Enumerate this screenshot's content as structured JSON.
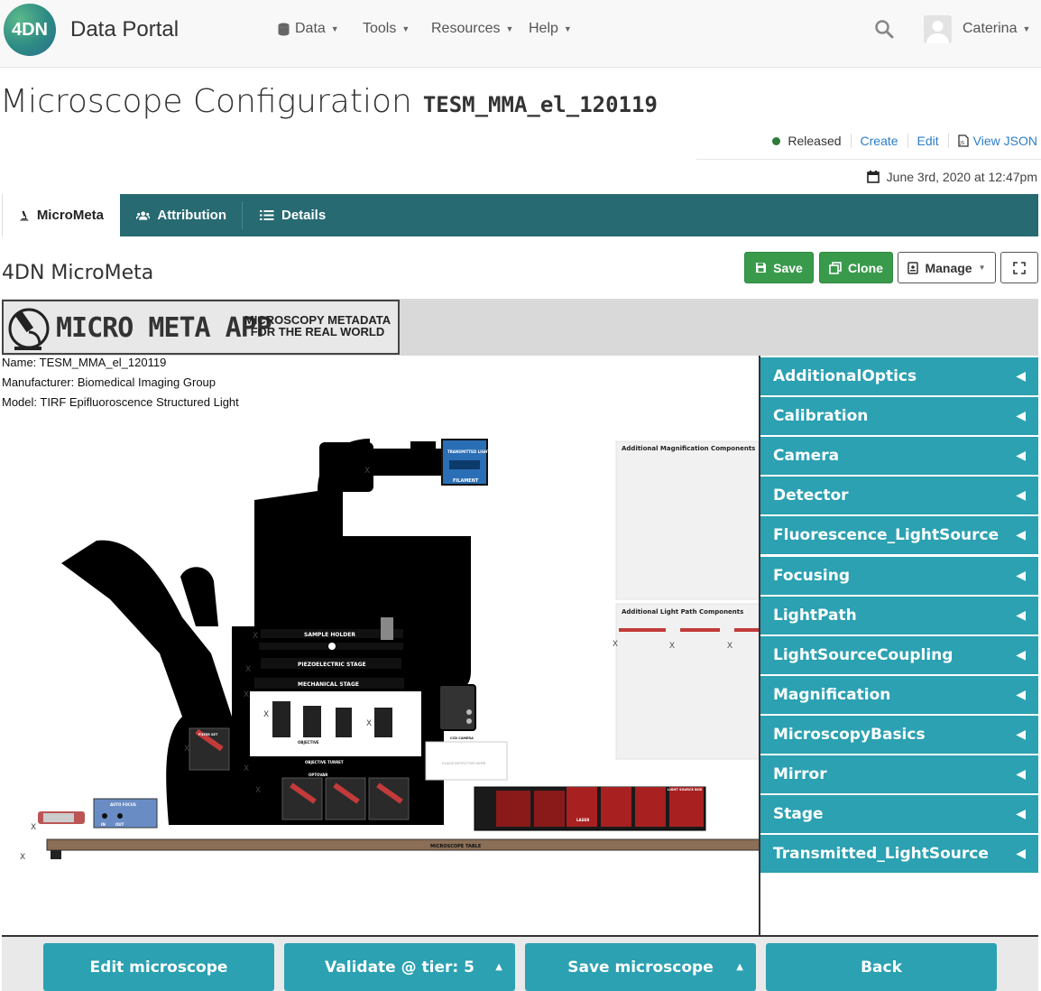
{
  "nav": {
    "logo": "4DN",
    "brand": "Data Portal",
    "menu": [
      {
        "label": "Data"
      },
      {
        "label": "Tools"
      },
      {
        "label": "Resources"
      },
      {
        "label": "Help"
      }
    ],
    "user": "Caterina"
  },
  "page": {
    "title": "Microscope Configuration",
    "accession": "TESM_MMA_el_120119",
    "status": "Released",
    "actions": [
      "Create",
      "Edit",
      "View JSON"
    ],
    "date": "June 3rd, 2020 at 12:47pm",
    "status_color": "#2d7a3a"
  },
  "tabs": [
    {
      "label": "MicroMeta",
      "icon": "microscope-icon"
    },
    {
      "label": "Attribution",
      "icon": "users-icon"
    },
    {
      "label": "Details",
      "icon": "list-icon"
    }
  ],
  "micrometa": {
    "title": "4DN MicroMeta",
    "save": "Save",
    "clone": "Clone",
    "manage": "Manage"
  },
  "app": {
    "logo_title": "MICRO META APP",
    "logo_tagline_1": "MICROSCOPY METADATA",
    "logo_tagline_2": "FOR THE REAL WORLD",
    "name": "Name: TESM_MMA_el_120119",
    "manufacturer": "Manufacturer: Biomedical Imaging Group",
    "model": "Model: TIRF Epifluoroscence Structured Light",
    "panel_mag": "Additional Magnification Components",
    "panel_light": "Additional Light Path Components",
    "labels": {
      "sample_holder": "SAMPLE HOLDER",
      "piezo": "PIEZOELECTRIC STAGE",
      "mech": "MECHANICAL STAGE",
      "table": "MICROSCOPE TABLE",
      "turret": "OBJECTIVE TURRET",
      "optovar": "OPTOVAR",
      "filament": "FILAMENT",
      "transmitted": "TRANSMITTED LIGHT SOURCE",
      "auto_focus": "AUTO FOCUS",
      "in": "IN",
      "out": "OUT",
      "objective": "OBJECTIVE",
      "laser": "LASER",
      "detector_hint": "PLACE DETECTOR HERE",
      "filter_set": "FILTER SET",
      "light_source_box": "LIGHT SOURCE BOX",
      "ccd": "CCD CAMERA"
    },
    "categories": [
      "AdditionalOptics",
      "Calibration",
      "Camera",
      "Detector",
      "Fluorescence_LightSource",
      "Focusing",
      "LightPath",
      "LightSourceCoupling",
      "Magnification",
      "MicroscopyBasics",
      "Mirror",
      "Stage",
      "Transmitted_LightSource"
    ],
    "accent": "#2ba1b2"
  },
  "bottom": {
    "edit": "Edit microscope",
    "validate": "Validate @ tier: 5",
    "save": "Save microscope",
    "back": "Back"
  }
}
